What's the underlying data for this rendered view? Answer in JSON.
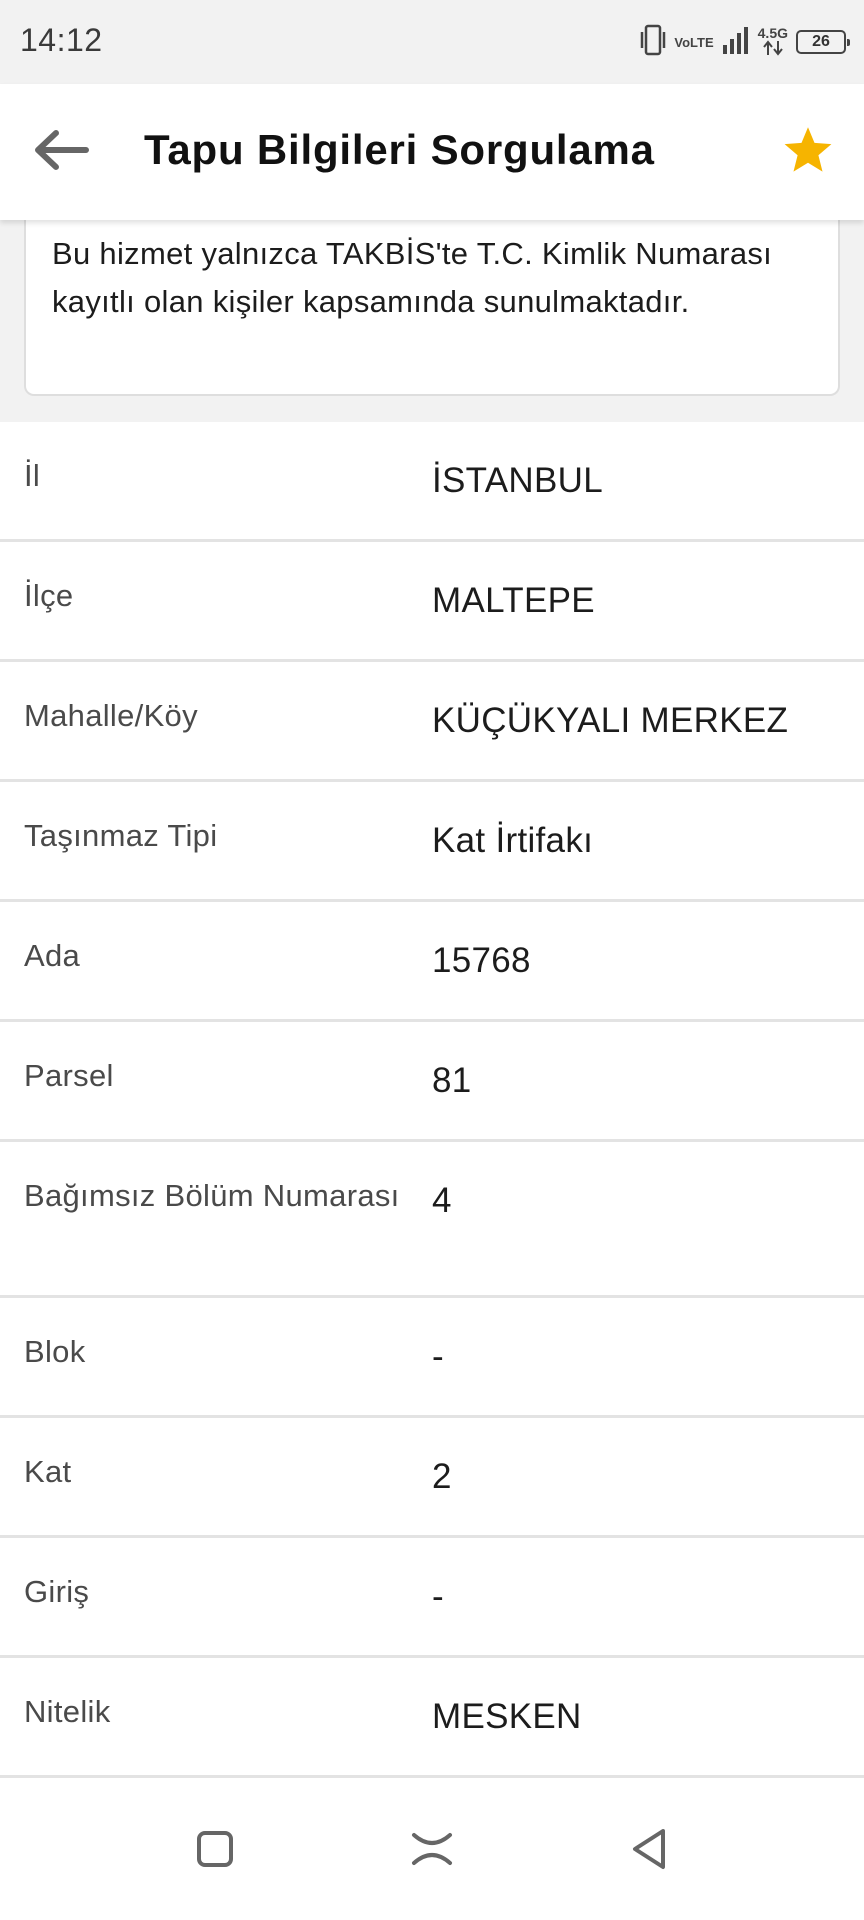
{
  "status_bar": {
    "time": "14:12",
    "volte": "VoLTE",
    "network": "4.5G",
    "battery": "26"
  },
  "app_bar": {
    "title": "Tapu Bilgileri Sorgulama",
    "back_icon": "arrow-left-icon",
    "favorite_icon": "star-icon",
    "star_color": "#f6b400"
  },
  "notice": {
    "text": "Bu hizmet yalnızca TAKBİS'te T.C. Kimlik Numarası kayıtlı olan kişiler kapsamında sunulmaktadır."
  },
  "rows": [
    {
      "label": "İl",
      "value": "İSTANBUL"
    },
    {
      "label": "İlçe",
      "value": "MALTEPE"
    },
    {
      "label": "Mahalle/Köy",
      "value": "KÜÇÜKYALI MERKEZ"
    },
    {
      "label": "Taşınmaz Tipi",
      "value": "Kat İrtifakı"
    },
    {
      "label": "Ada",
      "value": "15768"
    },
    {
      "label": "Parsel",
      "value": "81"
    },
    {
      "label": "Bağımsız Bölüm Numarası",
      "value": "4"
    },
    {
      "label": "Blok",
      "value": "-"
    },
    {
      "label": "Kat",
      "value": "2"
    },
    {
      "label": "Giriş",
      "value": "-"
    },
    {
      "label": "Nitelik",
      "value": "MESKEN"
    }
  ],
  "nav_bar": {
    "home_icon": "square-icon",
    "recents_icon": "recents-icon",
    "back_icon": "triangle-back-icon"
  }
}
